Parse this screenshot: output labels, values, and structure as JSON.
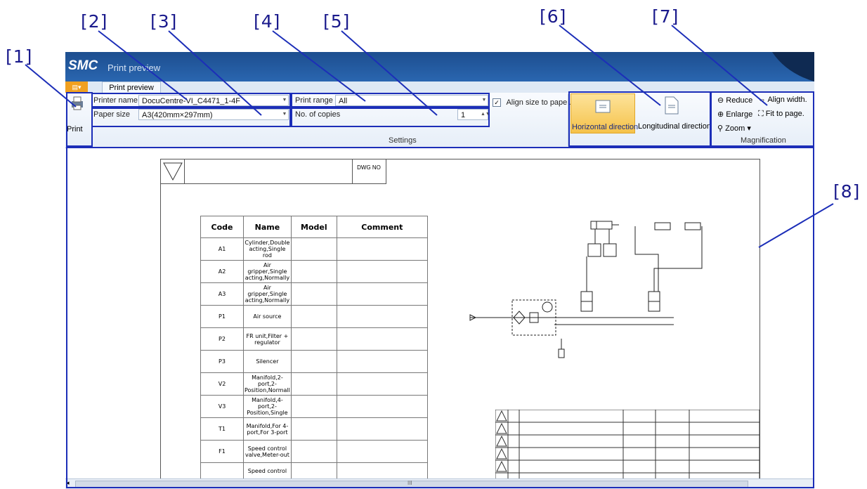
{
  "callouts": [
    "[1]",
    "[2]",
    "[3]",
    "[4]",
    "[5]",
    "[6]",
    "[7]",
    "[8]"
  ],
  "window": {
    "logo": "SMC",
    "title": "Print preview"
  },
  "ribbon": {
    "tab_label": "Print preview",
    "print_label": "Print",
    "printer_name_label": "Printer name",
    "printer_name_value": "DocuCentre-VI_C4471_1-4F",
    "paper_size_label": "Paper size",
    "paper_size_value": "A3(420mm×297mm)",
    "print_range_label": "Print range",
    "print_range_value": "All",
    "copies_label": "No. of copies",
    "copies_value": "1",
    "align_label": "Align size to paper.",
    "settings_title": "Settings",
    "horizontal_label": "Horizontal direction",
    "longitudinal_label": "Longitudinal direction",
    "reduce_label": "Reduce",
    "align_width_label": "Align width.",
    "enlarge_label": "Enlarge",
    "fit_label": "Fit to page.",
    "zoom_label": "Zoom",
    "magnification_title": "Magnification"
  },
  "sheet": {
    "dwg_no": "DWG NO",
    "table_headers": [
      "Code",
      "Name",
      "Model",
      "Comment"
    ],
    "rows": [
      {
        "code": "A1",
        "name": "Cylinder,Double acting,Single rod"
      },
      {
        "code": "A2",
        "name": "Air gripper,Single acting,Normally"
      },
      {
        "code": "A3",
        "name": "Air gripper,Single acting,Normally"
      },
      {
        "code": "P1",
        "name": "Air source"
      },
      {
        "code": "P2",
        "name": "FR unit,Filter + regulator"
      },
      {
        "code": "P3",
        "name": "Silencer"
      },
      {
        "code": "V2",
        "name": "Manifold,2-port,2-Position,Normall"
      },
      {
        "code": "V3",
        "name": "Manifold,4-port,2-Position,Single"
      },
      {
        "code": "T1",
        "name": "Manifold,For 4-port,For 3-port"
      },
      {
        "code": "F1",
        "name": "Speed control valve,Meter-out"
      },
      {
        "code": "",
        "name": "Speed control"
      }
    ]
  },
  "scrollbar_grip": "III",
  "colors": {
    "accent": "#f5c24a",
    "callout": "#1a1a8c",
    "highlight": "#1c2eb8",
    "titlebar": "#2a66b0"
  }
}
